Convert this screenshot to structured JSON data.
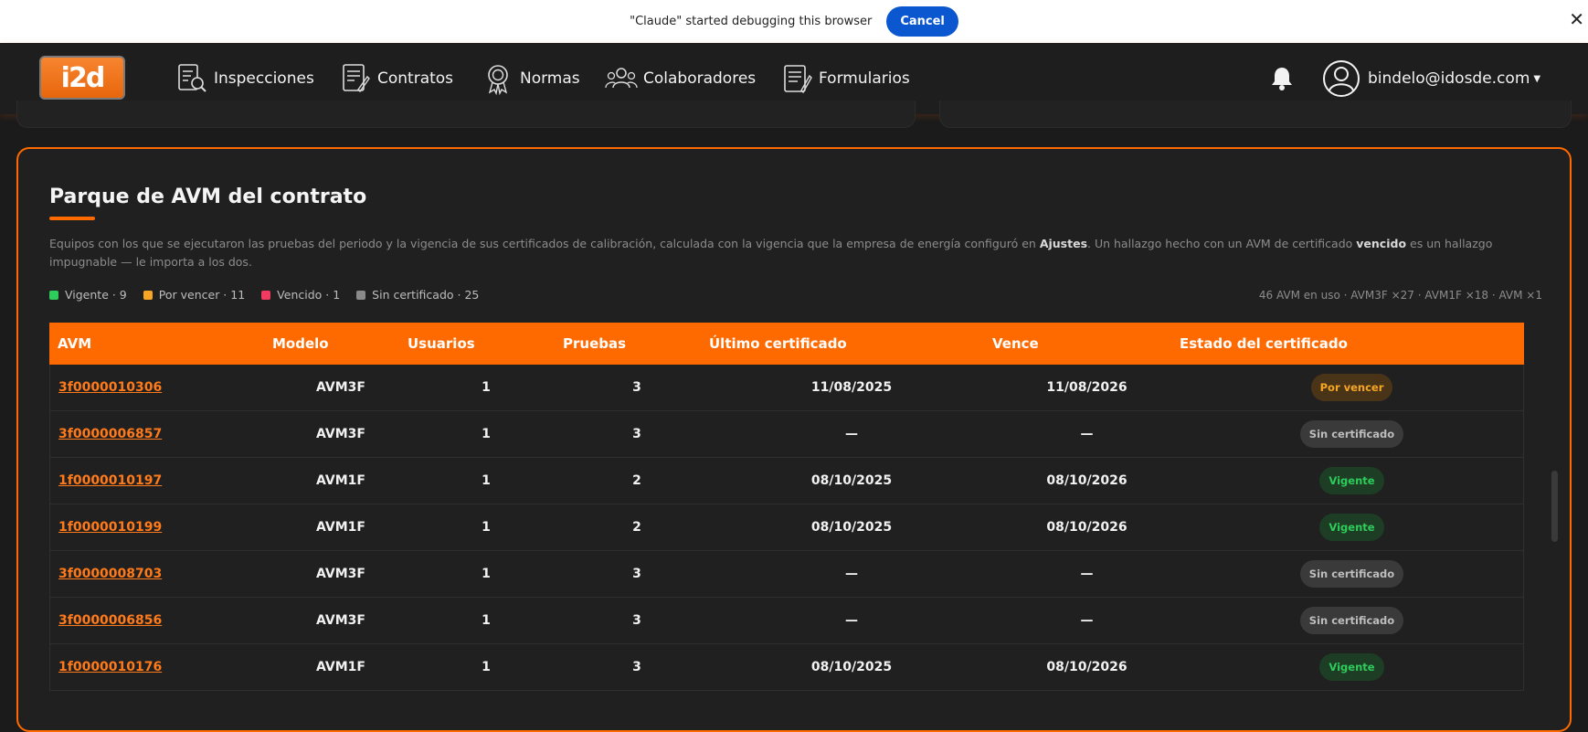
{
  "debug_bar": {
    "message": "\"Claude\" started debugging this browser",
    "cancel_label": "Cancel",
    "close_glyph": "✕"
  },
  "nav": {
    "logo_text": "i2d",
    "items": [
      {
        "label": "Inspecciones",
        "icon": "inspection-icon"
      },
      {
        "label": "Contratos",
        "icon": "contract-icon"
      },
      {
        "label": "Normas",
        "icon": "badge-icon"
      },
      {
        "label": "Colaboradores",
        "icon": "users-icon"
      },
      {
        "label": "Formularios",
        "icon": "form-icon"
      }
    ],
    "user_email": "bindelo@idosde.com"
  },
  "panel": {
    "title": "Parque de AVM del contrato",
    "desc_part1": "Equipos con los que se ejecutaron las pruebas del periodo y la vigencia de sus certificados de calibración, calculada con la vigencia que la empresa de energía configuró en ",
    "desc_bold1": "Ajustes",
    "desc_part2": ". Un hallazgo hecho con un AVM de certificado ",
    "desc_bold2": "vencido",
    "desc_part3": " es un hallazgo impugnable — le importa a los dos.",
    "legend": [
      {
        "label": "Vigente · 9",
        "color": "#2ecc5a"
      },
      {
        "label": "Por vencer · 11",
        "color": "#f6a623"
      },
      {
        "label": "Vencido · 1",
        "color": "#f03a5f"
      },
      {
        "label": "Sin certificado · 25",
        "color": "#8a8a8a"
      }
    ],
    "summary": "46 AVM en uso · AVM3F ×27 · AVM1F ×18 · AVM ×1"
  },
  "table": {
    "headers": [
      "AVM",
      "Modelo",
      "Usuarios",
      "Pruebas",
      "Último certificado",
      "Vence",
      "Estado del certificado"
    ],
    "rows": [
      {
        "avm": "3f0000010306",
        "modelo": "AVM3F",
        "usuarios": "1",
        "pruebas": "3",
        "ultimo": "11/08/2025",
        "vence": "11/08/2026",
        "estado": "Por vencer",
        "kind": "por"
      },
      {
        "avm": "3f0000006857",
        "modelo": "AVM3F",
        "usuarios": "1",
        "pruebas": "3",
        "ultimo": "—",
        "vence": "—",
        "estado": "Sin certificado",
        "kind": "sin"
      },
      {
        "avm": "1f0000010197",
        "modelo": "AVM1F",
        "usuarios": "1",
        "pruebas": "2",
        "ultimo": "08/10/2025",
        "vence": "08/10/2026",
        "estado": "Vigente",
        "kind": "vig"
      },
      {
        "avm": "1f0000010199",
        "modelo": "AVM1F",
        "usuarios": "1",
        "pruebas": "2",
        "ultimo": "08/10/2025",
        "vence": "08/10/2026",
        "estado": "Vigente",
        "kind": "vig"
      },
      {
        "avm": "3f0000008703",
        "modelo": "AVM3F",
        "usuarios": "1",
        "pruebas": "3",
        "ultimo": "—",
        "vence": "—",
        "estado": "Sin certificado",
        "kind": "sin"
      },
      {
        "avm": "3f0000006856",
        "modelo": "AVM3F",
        "usuarios": "1",
        "pruebas": "3",
        "ultimo": "—",
        "vence": "—",
        "estado": "Sin certificado",
        "kind": "sin"
      },
      {
        "avm": "1f0000010176",
        "modelo": "AVM1F",
        "usuarios": "1",
        "pruebas": "3",
        "ultimo": "08/10/2025",
        "vence": "08/10/2026",
        "estado": "Vigente",
        "kind": "vig"
      }
    ]
  }
}
